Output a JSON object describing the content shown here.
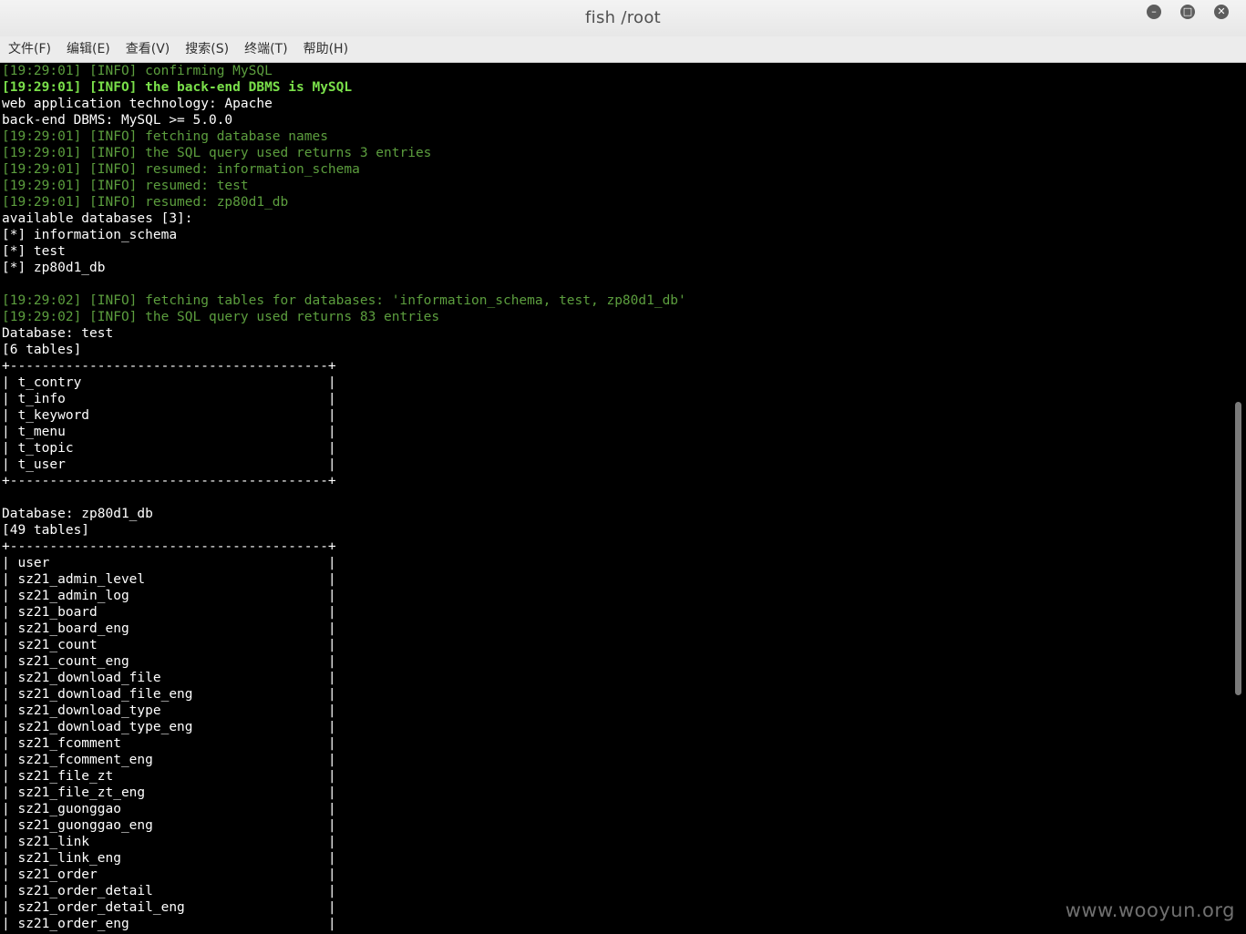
{
  "window": {
    "title": "fish  /root",
    "buttons": {
      "minimize": "–",
      "maximize": "□",
      "close": "✕"
    }
  },
  "menubar": {
    "items": [
      "文件(F)",
      "编辑(E)",
      "查看(V)",
      "搜索(S)",
      "终端(T)",
      "帮助(H)"
    ]
  },
  "colors": {
    "white": "#ffffff",
    "green": "#5c9e3e",
    "bright_green": "#7ae04a",
    "background": "#000000"
  },
  "terminal": {
    "lines": [
      {
        "t": "[19:29:01] [INFO] confirming MySQL",
        "c": "green"
      },
      {
        "t": "[19:29:01] [INFO] the back-end DBMS is MySQL",
        "c": "bgreen"
      },
      {
        "t": "web application technology: Apache",
        "c": "white"
      },
      {
        "t": "back-end DBMS: MySQL >= 5.0.0",
        "c": "white"
      },
      {
        "t": "[19:29:01] [INFO] fetching database names",
        "c": "green"
      },
      {
        "t": "[19:29:01] [INFO] the SQL query used returns 3 entries",
        "c": "green"
      },
      {
        "t": "[19:29:01] [INFO] resumed: information_schema",
        "c": "green"
      },
      {
        "t": "[19:29:01] [INFO] resumed: test",
        "c": "green"
      },
      {
        "t": "[19:29:01] [INFO] resumed: zp80d1_db",
        "c": "green"
      },
      {
        "t": "available databases [3]:",
        "c": "white"
      },
      {
        "t": "[*] information_schema",
        "c": "white"
      },
      {
        "t": "[*] test",
        "c": "white"
      },
      {
        "t": "[*] zp80d1_db",
        "c": "white"
      },
      {
        "t": "",
        "c": "white"
      },
      {
        "t": "[19:29:02] [INFO] fetching tables for databases: 'information_schema, test, zp80d1_db'",
        "c": "green"
      },
      {
        "t": "[19:29:02] [INFO] the SQL query used returns 83 entries",
        "c": "green"
      },
      {
        "t": "Database: test",
        "c": "white"
      },
      {
        "t": "[6 tables]",
        "c": "white"
      },
      {
        "t": "+----------------------------------------+",
        "c": "white"
      },
      {
        "t": "| t_contry                               |",
        "c": "white"
      },
      {
        "t": "| t_info                                 |",
        "c": "white"
      },
      {
        "t": "| t_keyword                              |",
        "c": "white"
      },
      {
        "t": "| t_menu                                 |",
        "c": "white"
      },
      {
        "t": "| t_topic                                |",
        "c": "white"
      },
      {
        "t": "| t_user                                 |",
        "c": "white"
      },
      {
        "t": "+----------------------------------------+",
        "c": "white"
      },
      {
        "t": "",
        "c": "white"
      },
      {
        "t": "Database: zp80d1_db",
        "c": "white"
      },
      {
        "t": "[49 tables]",
        "c": "white"
      },
      {
        "t": "+----------------------------------------+",
        "c": "white"
      },
      {
        "t": "| user                                   |",
        "c": "white"
      },
      {
        "t": "| sz21_admin_level                       |",
        "c": "white"
      },
      {
        "t": "| sz21_admin_log                         |",
        "c": "white"
      },
      {
        "t": "| sz21_board                             |",
        "c": "white"
      },
      {
        "t": "| sz21_board_eng                         |",
        "c": "white"
      },
      {
        "t": "| sz21_count                             |",
        "c": "white"
      },
      {
        "t": "| sz21_count_eng                         |",
        "c": "white"
      },
      {
        "t": "| sz21_download_file                     |",
        "c": "white"
      },
      {
        "t": "| sz21_download_file_eng                 |",
        "c": "white"
      },
      {
        "t": "| sz21_download_type                     |",
        "c": "white"
      },
      {
        "t": "| sz21_download_type_eng                 |",
        "c": "white"
      },
      {
        "t": "| sz21_fcomment                          |",
        "c": "white"
      },
      {
        "t": "| sz21_fcomment_eng                      |",
        "c": "white"
      },
      {
        "t": "| sz21_file_zt                           |",
        "c": "white"
      },
      {
        "t": "| sz21_file_zt_eng                       |",
        "c": "white"
      },
      {
        "t": "| sz21_guonggao                          |",
        "c": "white"
      },
      {
        "t": "| sz21_guonggao_eng                      |",
        "c": "white"
      },
      {
        "t": "| sz21_link                              |",
        "c": "white"
      },
      {
        "t": "| sz21_link_eng                          |",
        "c": "white"
      },
      {
        "t": "| sz21_order                             |",
        "c": "white"
      },
      {
        "t": "| sz21_order_detail                      |",
        "c": "white"
      },
      {
        "t": "| sz21_order_detail_eng                  |",
        "c": "white"
      },
      {
        "t": "| sz21_order_eng                         |",
        "c": "white"
      }
    ]
  },
  "watermark": "www.wooyun.org"
}
